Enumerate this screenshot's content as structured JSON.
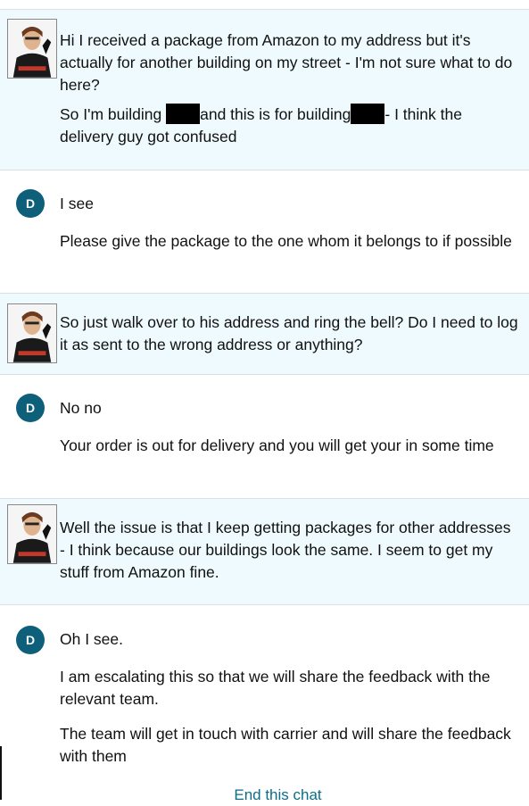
{
  "chat": {
    "agent_initial": "D",
    "messages": [
      {
        "sender": "customer",
        "paragraphs": [
          "Hi I received a package from Amazon to my address but it's actually for another building on my street - I'm not sure what to do here?"
        ],
        "p2": {
          "a": "So I'm building ",
          "b": "and this is for building",
          "c": "- I think the delivery guy got confused"
        }
      },
      {
        "sender": "agent",
        "paragraphs": [
          "I see",
          "Please give the package to the one whom it belongs to if possible"
        ]
      },
      {
        "sender": "customer",
        "paragraphs": [
          "So just walk over to his address and ring the bell? Do I need to log it as sent to the wrong address or anything?"
        ]
      },
      {
        "sender": "agent",
        "paragraphs": [
          "No no",
          "Your order is out for delivery and you will get your in some time"
        ]
      },
      {
        "sender": "customer",
        "paragraphs": [
          "Well the issue is that I keep getting packages for other addresses - I think because our buildings look the same. I seem to get my stuff from Amazon fine."
        ]
      },
      {
        "sender": "agent",
        "paragraphs": [
          "Oh I see.",
          "I am escalating this so that we will share the feedback with the relevant team.",
          "The team will get in touch with carrier and will share the feedback with them"
        ]
      }
    ],
    "end_chat_label": "End this chat"
  },
  "colors": {
    "customer_bg": "#eefafd",
    "agent_avatar": "#0d5f7a",
    "link": "#0c6d86"
  },
  "icons": {
    "customer_avatar": "customer-avatar-icon",
    "agent_avatar": "agent-avatar-icon"
  }
}
